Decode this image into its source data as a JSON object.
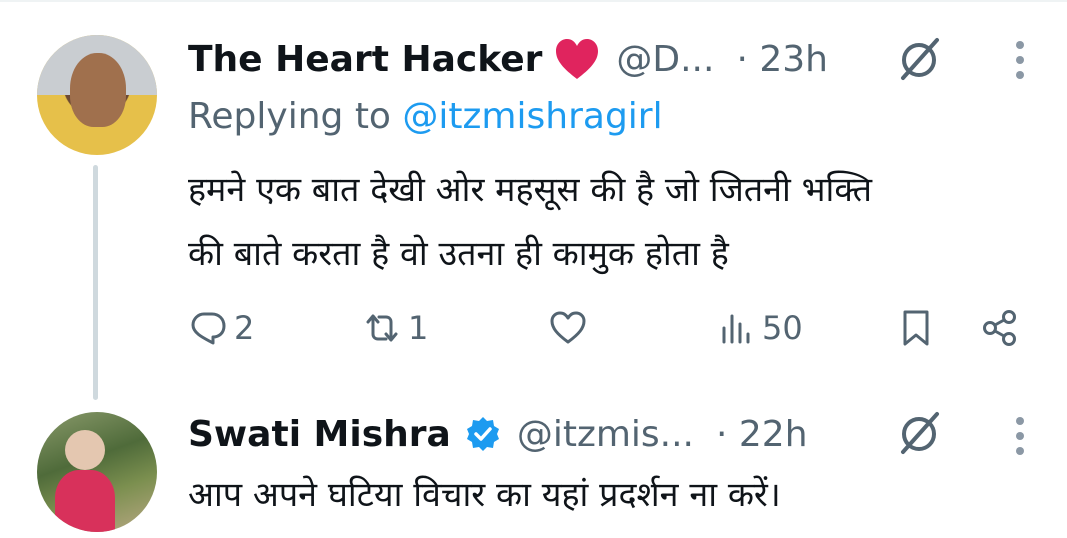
{
  "tweets": [
    {
      "display_name": "The Heart Hacker",
      "name_emoji": "heart",
      "handle": "@D...",
      "time": "· 23h",
      "replying_to_label": "Replying to",
      "replying_to_handle": "@itzmishragirl",
      "text_lines": [
        "हमने एक बात देखी ओर महसूस की है जो जितनी भक्ति",
        "की बाते करता है वो उतना ही कामुक होता है"
      ],
      "counts": {
        "replies": "2",
        "reposts": "1",
        "likes": "",
        "views": "50"
      },
      "icons": [
        "grok-icon",
        "more-icon",
        "reply-icon",
        "retweet-icon",
        "like-icon",
        "views-icon",
        "bookmark-icon",
        "share-icon"
      ]
    },
    {
      "display_name": "Swati Mishra",
      "verified": true,
      "handle": "@itzmis...",
      "time": "· 22h",
      "text_lines": [
        "आप अपने घटिया विचार का यहां प्रदर्शन ना करें।"
      ],
      "icons": [
        "grok-icon",
        "more-icon"
      ]
    }
  ],
  "colors": {
    "text": "#0f1419",
    "secondary": "#536471",
    "link": "#1d9bf0",
    "heart": "#e0245e",
    "verified": "#1d9bf0",
    "thread_line": "#cfd9de"
  }
}
